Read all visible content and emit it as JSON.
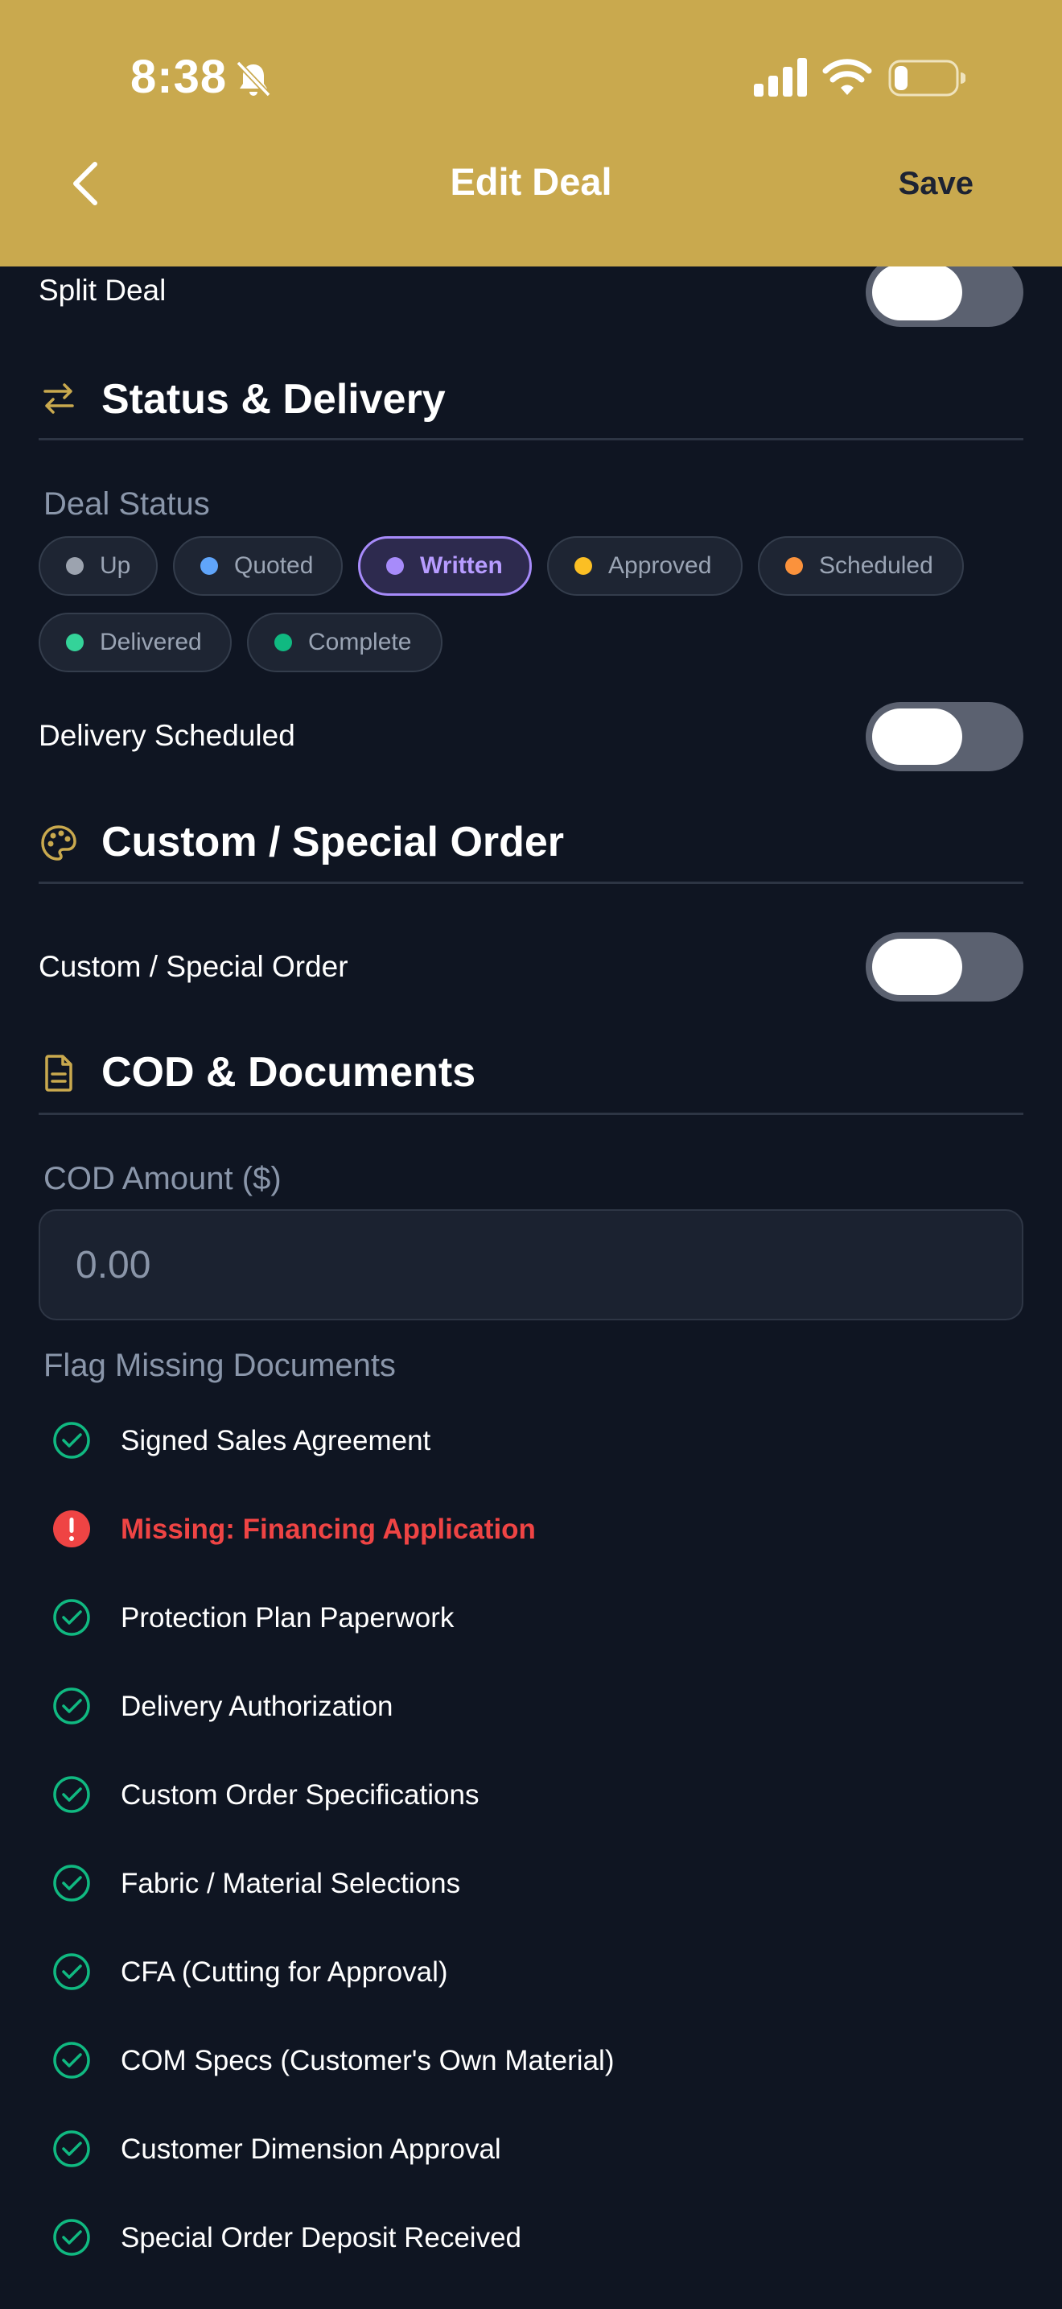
{
  "status_bar": {
    "time": "8:38"
  },
  "header": {
    "title": "Edit Deal",
    "save_label": "Save"
  },
  "split_deal": {
    "label": "Split Deal"
  },
  "status_section": {
    "title": "Status & Delivery",
    "deal_status_label": "Deal Status",
    "chips": [
      {
        "label": "Up",
        "color": "#9ca3af"
      },
      {
        "label": "Quoted",
        "color": "#60a5fa"
      },
      {
        "label": "Written",
        "color": "#a78bfa",
        "selected": true
      },
      {
        "label": "Approved",
        "color": "#fbbf24"
      },
      {
        "label": "Scheduled",
        "color": "#fb923c"
      },
      {
        "label": "Delivered",
        "color": "#34d399"
      },
      {
        "label": "Complete",
        "color": "#10b981"
      }
    ],
    "delivery_scheduled_label": "Delivery Scheduled"
  },
  "custom_section": {
    "title": "Custom / Special Order",
    "toggle_label": "Custom / Special Order"
  },
  "cod_section": {
    "title": "COD & Documents",
    "cod_label": "COD Amount ($)",
    "cod_placeholder": "0.00",
    "flag_label": "Flag Missing Documents",
    "documents": [
      {
        "label": "Signed Sales Agreement",
        "status": "ok"
      },
      {
        "label": "Missing: Financing Application",
        "status": "missing"
      },
      {
        "label": "Protection Plan Paperwork",
        "status": "ok"
      },
      {
        "label": "Delivery Authorization",
        "status": "ok"
      },
      {
        "label": "Custom Order Specifications",
        "status": "ok"
      },
      {
        "label": "Fabric / Material Selections",
        "status": "ok"
      },
      {
        "label": "CFA (Cutting for Approval)",
        "status": "ok"
      },
      {
        "label": "COM Specs (Customer's Own Material)",
        "status": "ok"
      },
      {
        "label": "Customer Dimension Approval",
        "status": "ok"
      },
      {
        "label": "Special Order Deposit Received",
        "status": "ok"
      }
    ]
  },
  "colors": {
    "header": "#c9a94e",
    "background": "#0f1522",
    "accent_gold": "#c9a94e",
    "ok_green": "#10b981",
    "missing_red": "#ef4444"
  }
}
